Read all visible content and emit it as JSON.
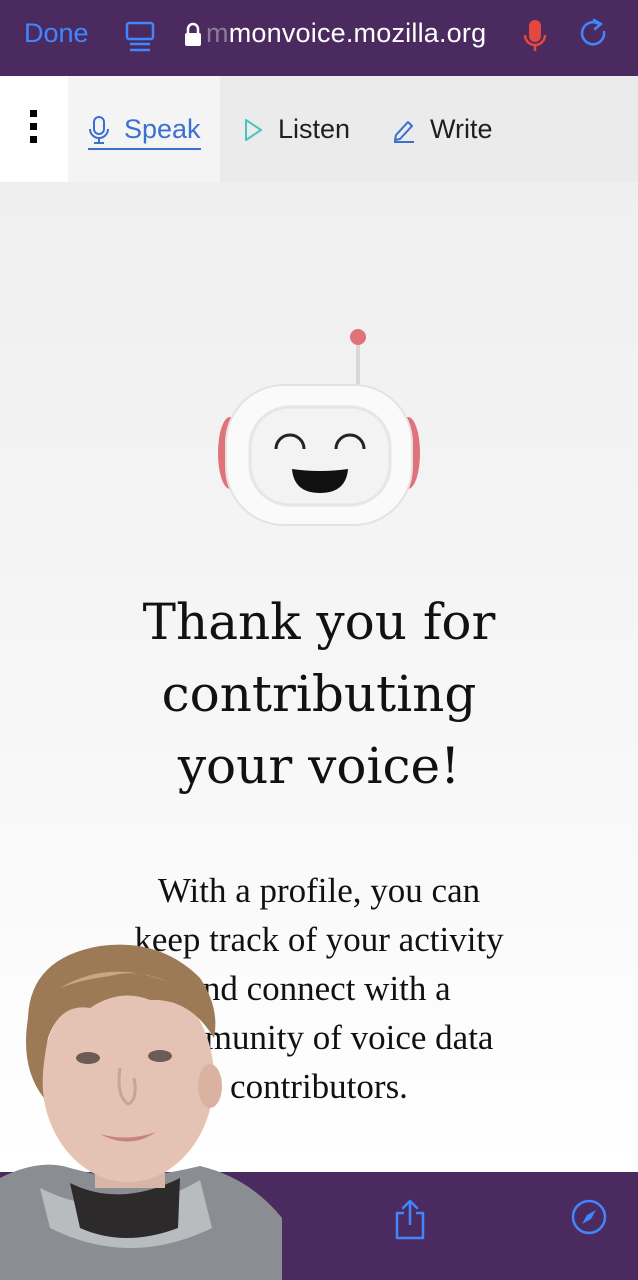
{
  "browser": {
    "done_label": "Done",
    "url_faded": "m",
    "url": "monvoice.mozilla.org",
    "reader_icon": "reader-icon",
    "lock_icon": "lock-icon",
    "mic_icon": "microphone-icon",
    "reload_icon": "reload-icon"
  },
  "nav": {
    "menu_icon": "more-vertical-icon",
    "items": [
      {
        "label": "Speak",
        "icon": "microphone-icon",
        "active": true
      },
      {
        "label": "Listen",
        "icon": "play-icon",
        "active": false
      },
      {
        "label": "Write",
        "icon": "pencil-icon",
        "active": false
      }
    ]
  },
  "content": {
    "headline_lines": [
      "Thank you for",
      "contributing",
      "your voice!"
    ],
    "body_lines": [
      "With a profile, you can",
      "keep track of your activity",
      "and connect with a",
      "community of voice data",
      "contributors."
    ]
  },
  "toolbar": {
    "share_icon": "share-icon",
    "compass_icon": "compass-icon"
  },
  "colors": {
    "browser_bar": "#4b2a5f",
    "accent_blue": "#3b6fd1",
    "safari_blue": "#3f86ff",
    "mic_red": "#e5483f",
    "listen_teal": "#4ec2c2"
  }
}
